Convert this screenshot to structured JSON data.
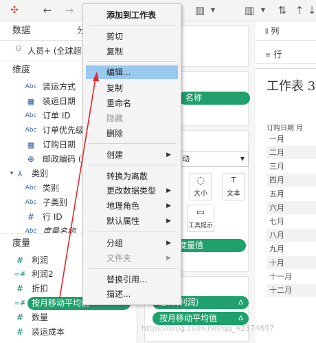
{
  "toolbar": {
    "icons": [
      "tableau-logo-icon",
      "back-arrow-icon",
      "forward-arrow-icon",
      "bar-chart-add-icon",
      "dropdown-icon",
      "bar-chart-clear-icon",
      "swap-icon",
      "sort-asc-icon",
      "sort-desc-icon"
    ]
  },
  "left_panel": {
    "tab_data": "数据",
    "tab_analysis": "分",
    "datasource": "人员+ (全球超",
    "dimensions_header": "维度",
    "dimensions": [
      {
        "icon": "Abc",
        "label": "装运方式"
      },
      {
        "icon": "date",
        "label": "装运日期"
      },
      {
        "icon": "Abc",
        "label": "订单 ID"
      },
      {
        "icon": "Abc",
        "label": "订单优先级"
      },
      {
        "icon": "date",
        "label": "订购日期"
      },
      {
        "icon": "geo",
        "label": "邮政编码 ("
      },
      {
        "icon": "hier",
        "label": "类别"
      },
      {
        "icon": "Abc",
        "label": "类别"
      },
      {
        "icon": "Abc",
        "label": "子类别"
      },
      {
        "icon": "#",
        "label": "行 ID"
      },
      {
        "icon": "Abc",
        "label": "度量名称"
      }
    ],
    "measures_header": "度量",
    "measures": [
      {
        "icon": "#",
        "label": "利润"
      },
      {
        "icon": "=#",
        "label": "利润2"
      },
      {
        "icon": "#",
        "label": "折扣"
      },
      {
        "icon": "=#",
        "label": "按月移动平均值"
      },
      {
        "icon": "#",
        "label": "数量"
      },
      {
        "icon": "#",
        "label": "装运成本"
      }
    ]
  },
  "middle": {
    "pill_name": "名称",
    "marks_type": "动",
    "mark_size": "大小",
    "mark_text": "文本",
    "mark_tooltip": "工具提示",
    "pill_measure_values": "度量值",
    "pill_profit": "总计(利润)",
    "pill_moving_avg": "按月移动平均值"
  },
  "right": {
    "columns_label": "列",
    "rows_label": "行",
    "sheet_title": "工作表 3",
    "header": "订购日期 月",
    "months": [
      "一月",
      "二月",
      "三月",
      "四月",
      "五月",
      "六月",
      "七月",
      "八月",
      "九月",
      "十月",
      "十一月",
      "十二月"
    ]
  },
  "context_menu": {
    "items": [
      {
        "label": "添加到工作表",
        "bold": true
      },
      {
        "label": "剪切"
      },
      {
        "label": "复制"
      },
      {
        "label": "编辑...",
        "highlight": true
      },
      {
        "label": "复制"
      },
      {
        "label": "重命名"
      },
      {
        "label": "隐藏",
        "disabled": true
      },
      {
        "label": "删除"
      },
      {
        "label": "创建",
        "submenu": true
      },
      {
        "label": "转换为离散"
      },
      {
        "label": "更改数据类型",
        "submenu": true
      },
      {
        "label": "地理角色",
        "submenu": true
      },
      {
        "label": "默认属性",
        "submenu": true
      },
      {
        "label": "分组",
        "submenu": true
      },
      {
        "label": "文件夹",
        "submenu": true,
        "disabled": true
      },
      {
        "label": "替换引用..."
      },
      {
        "label": "描述..."
      }
    ]
  },
  "watermark": "https://blog.csdn.net/qq_42374697",
  "colors": {
    "pill": "#1fa06c",
    "highlight": "#99c8f0",
    "arrow": "#e0262b"
  }
}
